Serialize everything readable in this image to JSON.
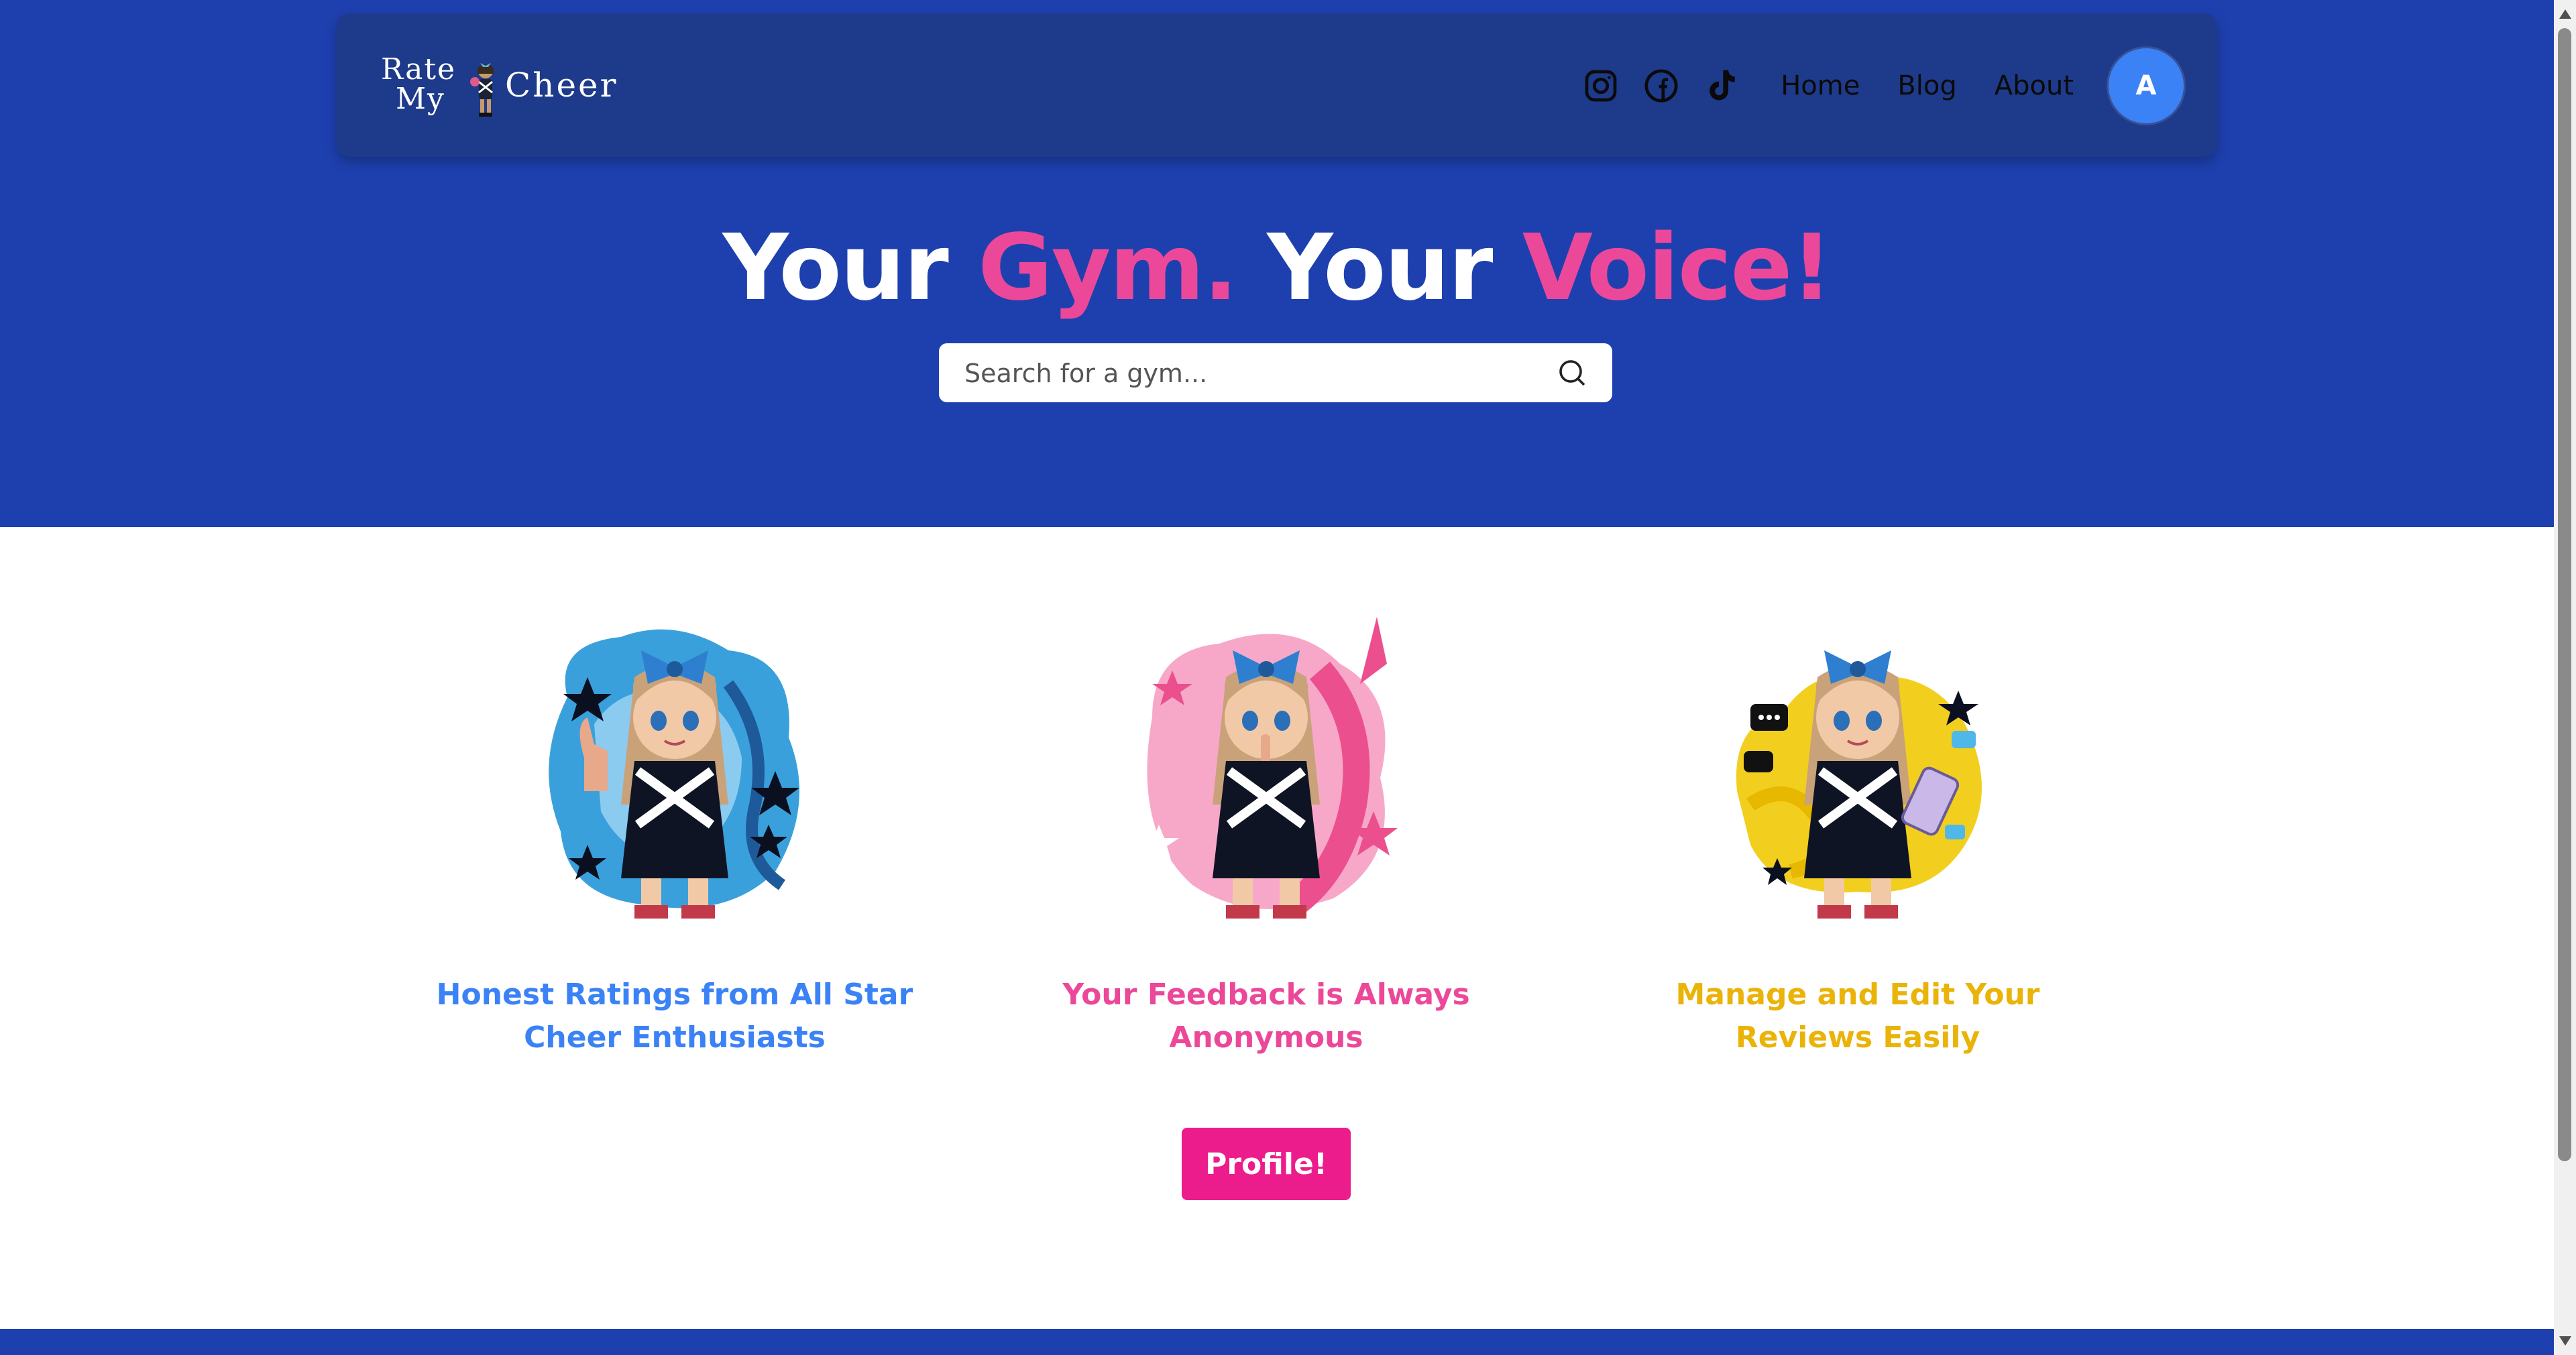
{
  "logo": {
    "line1": "Rate",
    "line2": "My",
    "line3": "Cheer"
  },
  "nav": {
    "social": [
      "instagram-icon",
      "facebook-icon",
      "tiktok-icon"
    ],
    "links": [
      "Home",
      "Blog",
      "About"
    ],
    "avatar_initial": "A"
  },
  "hero": {
    "part1": "Your ",
    "part2": "Gym.",
    "part3": " Your ",
    "part4": "Voice!",
    "search_placeholder": "Search for a gym..."
  },
  "features": [
    {
      "caption": "Honest Ratings from All Star Cheer Enthusiasts",
      "color": "#3b82f6",
      "icon": "thumbs-up-cheerleader"
    },
    {
      "caption": "Your Feedback is Always Anonymous",
      "color": "#ec4899",
      "icon": "shush-cheerleader"
    },
    {
      "caption": "Manage and Edit Your Reviews Easily",
      "color": "#eab308",
      "icon": "phone-cheerleader"
    }
  ],
  "cta": {
    "label": "Profile!"
  },
  "colors": {
    "hero_bg": "#1e40af",
    "nav_bg": "#1e3a8a",
    "accent_pink": "#ec4899",
    "button_pink": "#ec1c8c",
    "avatar_blue": "#3b82f6"
  }
}
